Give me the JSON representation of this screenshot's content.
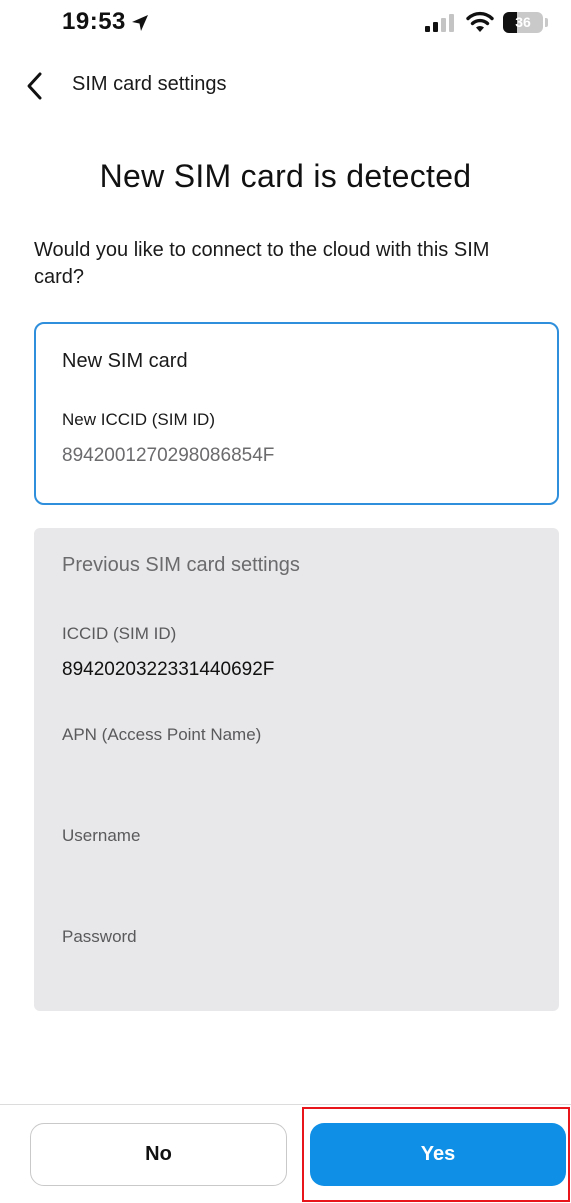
{
  "status_bar": {
    "time": "19:53",
    "battery_level": "36",
    "battery_fraction": 0.36,
    "icons": [
      "location-arrow-icon",
      "cellular-signal-icon",
      "wifi-icon",
      "battery-icon"
    ]
  },
  "header": {
    "back_icon": "chevron-left-icon",
    "title": "SIM card settings"
  },
  "main": {
    "page_title": "New SIM card is detected",
    "prompt": "Would you like to connect to the cloud with this SIM card?"
  },
  "new_sim_card": {
    "title": "New SIM card",
    "iccid_label": "New ICCID (SIM ID)",
    "iccid_value": "8942001270298086854F",
    "border_color": "#2f8fdc"
  },
  "previous_settings": {
    "title": "Previous SIM card settings",
    "iccid_label": "ICCID (SIM ID)",
    "iccid_value": "8942020322331440692F",
    "apn_label": "APN (Access Point Name)",
    "apn_value": "",
    "username_label": "Username",
    "username_value": "",
    "password_label": "Password",
    "password_value": "",
    "background_color": "#e8e8ea"
  },
  "actions": {
    "no_label": "No",
    "yes_label": "Yes",
    "yes_color": "#0f8fe6",
    "highlight_color": "#e8161b"
  }
}
